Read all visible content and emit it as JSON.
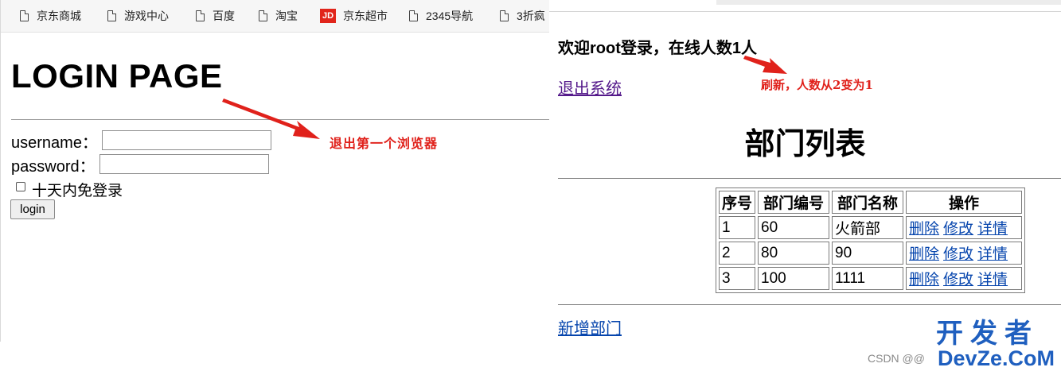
{
  "left_window": {
    "bookmarks": [
      {
        "label": "京东商城",
        "icon": "document-icon"
      },
      {
        "label": "游戏中心",
        "icon": "document-icon"
      },
      {
        "label": "百度",
        "icon": "document-icon"
      },
      {
        "label": "淘宝",
        "icon": "document-icon"
      },
      {
        "label": "京东超市",
        "icon": "jd-logo-icon",
        "icon_text": "JD"
      },
      {
        "label": "2345导航",
        "icon": "document-icon"
      },
      {
        "label": "3折疯",
        "icon": "document-icon"
      }
    ],
    "page_title": "LOGIN PAGE",
    "username_label": "username：",
    "password_label": "password：",
    "username_value": "",
    "password_value": "",
    "remember_label": "十天内免登录",
    "remember_checked": false,
    "login_button": "login"
  },
  "right_window": {
    "welcome": "欢迎root登录，在线人数1人",
    "logout_link": "退出系统",
    "page_title": "部门列表",
    "table": {
      "headers": [
        "序号",
        "部门编号",
        "部门名称",
        "操作"
      ],
      "rows": [
        {
          "index": "1",
          "dept_no": "60",
          "dept_name": "火箭部"
        },
        {
          "index": "2",
          "dept_no": "80",
          "dept_name": "90"
        },
        {
          "index": "3",
          "dept_no": "100",
          "dept_name": "1111"
        }
      ],
      "actions": [
        "删除",
        "修改",
        "详情"
      ]
    },
    "add_link": "新增部门"
  },
  "annotations": {
    "exit_first_browser": "退出第一个浏览器",
    "refresh_note": "刷新，人数从2变为1",
    "color": "#e0211b"
  },
  "watermark": {
    "csdn": "CSDN @@",
    "brand_line1": "开发者",
    "brand_line2": "DevZe.CoM"
  },
  "colors": {
    "link": "#0645ad",
    "visited_link": "#551a8b",
    "annotation": "#e0211b",
    "watermark_blue": "#1f5fbf"
  }
}
